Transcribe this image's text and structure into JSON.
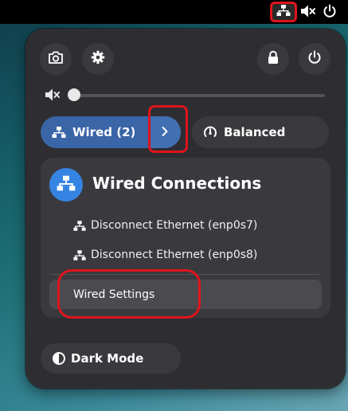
{
  "topbar": {
    "icons": [
      "network-wired-icon",
      "audio-muted-icon",
      "power-icon"
    ]
  },
  "quick_settings": {
    "top_buttons": [
      {
        "name": "screenshot",
        "icon": "camera-icon"
      },
      {
        "name": "settings",
        "icon": "gear-icon"
      },
      {
        "name": "lock",
        "icon": "lock-icon"
      },
      {
        "name": "power",
        "icon": "power-icon"
      }
    ],
    "volume": {
      "icon": "speaker-muted-icon",
      "level": 0.0
    },
    "wired_toggle": {
      "label": "Wired (2)",
      "icon": "network-wired-icon",
      "active": true
    },
    "power_mode": {
      "label": "Balanced",
      "icon": "gauge-icon"
    },
    "dark_mode": {
      "label": "Dark Mode",
      "icon": "dark-mode-icon"
    }
  },
  "wired_menu": {
    "title": "Wired Connections",
    "items": [
      {
        "label": "Disconnect Ethernet (enp0s7)"
      },
      {
        "label": "Disconnect Ethernet (enp0s8)"
      }
    ],
    "settings_label": "Wired Settings"
  },
  "colors": {
    "accent": "#3584e4",
    "toggle_active": "#3a65a7",
    "popup_bg": "#2e2e32",
    "highlight": "#e0141c"
  }
}
